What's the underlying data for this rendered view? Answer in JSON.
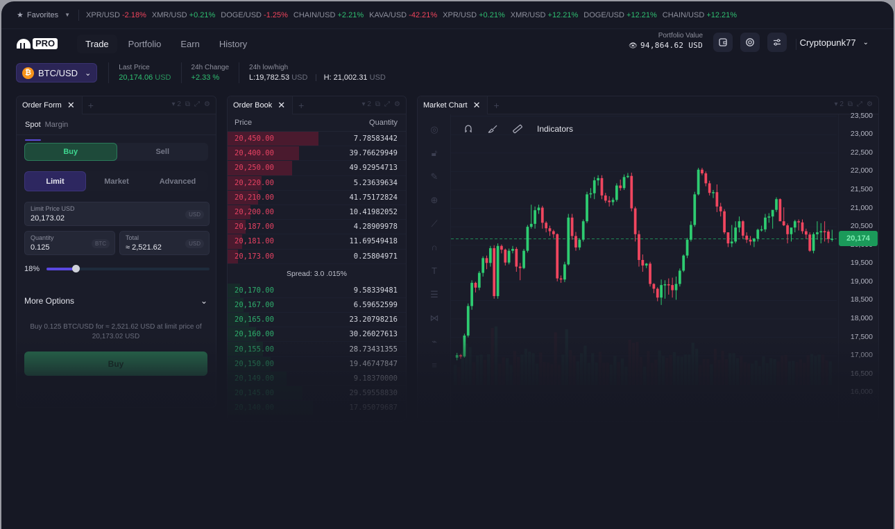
{
  "ticker": {
    "favorites_label": "Favorites",
    "items": [
      {
        "pair": "XPR/USD",
        "change": "-2.18%",
        "dir": "neg"
      },
      {
        "pair": "XMR/USD",
        "change": "+0.21%",
        "dir": "pos"
      },
      {
        "pair": "DOGE/USD",
        "change": "-1.25%",
        "dir": "neg"
      },
      {
        "pair": "CHAIN/USD",
        "change": "+2.21%",
        "dir": "pos"
      },
      {
        "pair": "KAVA/USD",
        "change": "-42.21%",
        "dir": "neg"
      },
      {
        "pair": "XPR/USD",
        "change": "+0.21%",
        "dir": "pos"
      },
      {
        "pair": "XMR/USD",
        "change": "+12.21%",
        "dir": "pos"
      },
      {
        "pair": "DOGE/USD",
        "change": "+12.21%",
        "dir": "pos"
      },
      {
        "pair": "CHAIN/USD",
        "change": "+12.21%",
        "dir": "pos"
      }
    ]
  },
  "nav": {
    "logo_text": "PRO",
    "tabs": [
      {
        "label": "Trade",
        "active": true
      },
      {
        "label": "Portfolio",
        "active": false
      },
      {
        "label": "Earn",
        "active": false
      },
      {
        "label": "History",
        "active": false
      }
    ],
    "portfolio_label": "Portfolio Value",
    "portfolio_value": "94,864.62 USD",
    "icons": [
      "wallet-icon",
      "support-icon",
      "settings-sliders-icon"
    ],
    "username": "Cryptopunk77"
  },
  "market": {
    "pair": "BTC/USD",
    "coin_symbol": "₿",
    "last_price_label": "Last Price",
    "last_price": "20,174.06",
    "last_price_unit": "USD",
    "change_label": "24h Change",
    "change_value": "+2.33 %",
    "lowhigh_label": "24h low/high",
    "low": "L:19,782.53",
    "high": "H: 21,002.31",
    "unit": "USD"
  },
  "order_form": {
    "title": "Order Form",
    "mode_tabs": [
      "Spot",
      "Margin"
    ],
    "active_mode": "Spot",
    "side_buy": "Buy",
    "side_sell": "Sell",
    "types": [
      "Limit",
      "Market",
      "Advanced"
    ],
    "active_type": "Limit",
    "limit_price_label": "Limit Price USD",
    "limit_price_value": "20,173.02",
    "limit_unit": "USD",
    "quantity_label": "Quantity",
    "quantity_value": "0.125",
    "quantity_unit": "BTC",
    "total_label": "Total",
    "total_value": "≈ 2,521.62",
    "total_unit": "USD",
    "slider_percent": 18,
    "slider_label": "18%",
    "more_options": "More Options",
    "summary": "Buy 0.125 BTC/USD for ≈ 2,521.62 USD at limit price of 20,173.02 USD",
    "submit_label": "Buy"
  },
  "order_book": {
    "title": "Order Book",
    "col_price": "Price",
    "col_quantity": "Quantity",
    "asks": [
      {
        "price": "20,450.00",
        "qty": "7.78583442",
        "depth": 0.51
      },
      {
        "price": "20,400.00",
        "qty": "39.76629949",
        "depth": 0.4
      },
      {
        "price": "20,250.00",
        "qty": "49.92954713",
        "depth": 0.36
      },
      {
        "price": "20,220.00",
        "qty": "5.23639634",
        "depth": 0.19
      },
      {
        "price": "20,210.00",
        "qty": "41.75172824",
        "depth": 0.17
      },
      {
        "price": "20,200.00",
        "qty": "10.41982052",
        "depth": 0.13
      },
      {
        "price": "20,187.00",
        "qty": "4.28909978",
        "depth": 0.1
      },
      {
        "price": "20,181.00",
        "qty": "11.69549418",
        "depth": 0.08
      },
      {
        "price": "20,173.00",
        "qty": "0.25804971",
        "depth": 0.06
      }
    ],
    "spread": "Spread: 3.0 .015%",
    "bids": [
      {
        "price": "20,170.00",
        "qty": "9.58339481",
        "depth": 0.07
      },
      {
        "price": "20,167.00",
        "qty": "6.59652599",
        "depth": 0.09
      },
      {
        "price": "20,165.00",
        "qty": "23.20798216",
        "depth": 0.12
      },
      {
        "price": "20,160.00",
        "qty": "30.26027613",
        "depth": 0.16
      },
      {
        "price": "20,155.00",
        "qty": "28.73431355",
        "depth": 0.2
      },
      {
        "price": "20,150.00",
        "qty": "19.46747847",
        "depth": 0.24
      },
      {
        "price": "20,149.00",
        "qty": "9.18370000",
        "depth": 0.33
      },
      {
        "price": "20,145.00",
        "qty": "29.59558830",
        "depth": 0.42
      },
      {
        "price": "20,140.00",
        "qty": "17.95079687",
        "depth": 0.48
      }
    ]
  },
  "market_chart": {
    "title": "Market Chart",
    "toolbar": [
      "magnet-icon",
      "brush-icon",
      "ruler-icon"
    ],
    "indicators_label": "Indicators",
    "current_price_label": "20,174",
    "current_price": 20174
  },
  "chart_data": {
    "type": "candlestick",
    "title": "BTC/USD",
    "ylim": [
      15800,
      23700
    ],
    "y_ticks": [
      "23,500",
      "23,000",
      "22,500",
      "22,000",
      "21,500",
      "21,000",
      "20,500",
      "20,000",
      "19,500",
      "19,000",
      "18,500",
      "18,000",
      "17,500",
      "17,000",
      "16,500",
      "16,000"
    ],
    "y_tick_values": [
      23500,
      23000,
      22500,
      22000,
      21500,
      21000,
      20500,
      20000,
      19500,
      19000,
      18500,
      18000,
      17500,
      17000,
      16500,
      16000
    ],
    "last_price": 20174,
    "candles": [
      [
        16950,
        17080,
        16880,
        17020
      ],
      [
        17020,
        17050,
        16920,
        16980
      ],
      [
        16980,
        17600,
        16950,
        17550
      ],
      [
        17550,
        18420,
        17500,
        18350
      ],
      [
        18350,
        19050,
        18250,
        18980
      ],
      [
        18980,
        19010,
        18720,
        18850
      ],
      [
        18850,
        19300,
        18780,
        19250
      ],
      [
        19250,
        19700,
        19150,
        19650
      ],
      [
        19650,
        19720,
        19350,
        19520
      ],
      [
        19520,
        19980,
        19420,
        19920
      ],
      [
        19920,
        20000,
        18550,
        18620
      ],
      [
        18620,
        20050,
        18550,
        19980
      ],
      [
        19980,
        20020,
        19780,
        19880
      ],
      [
        19880,
        19910,
        19450,
        19530
      ],
      [
        19530,
        19910,
        19480,
        19850
      ],
      [
        19850,
        19980,
        19780,
        19900
      ],
      [
        19900,
        19950,
        19280,
        19420
      ],
      [
        19420,
        19520,
        19050,
        19380
      ],
      [
        19380,
        19900,
        19350,
        19850
      ],
      [
        19850,
        20550,
        19800,
        20500
      ],
      [
        20500,
        21100,
        20450,
        20580
      ],
      [
        20580,
        21050,
        20450,
        20950
      ],
      [
        20950,
        21100,
        20850,
        21020
      ],
      [
        21020,
        21070,
        20450,
        20610
      ],
      [
        20610,
        20650,
        20350,
        20460
      ],
      [
        20460,
        20530,
        20250,
        20380
      ],
      [
        20380,
        20420,
        20200,
        20300
      ],
      [
        20300,
        20320,
        19020,
        19100
      ],
      [
        19100,
        19180,
        18980,
        19070
      ],
      [
        19070,
        19550,
        19000,
        19480
      ],
      [
        19480,
        20850,
        19450,
        20750
      ],
      [
        20750,
        20850,
        20150,
        20250
      ],
      [
        20250,
        20360,
        19850,
        19940
      ],
      [
        19940,
        20190,
        19870,
        20150
      ],
      [
        20150,
        20700,
        20100,
        20650
      ],
      [
        20650,
        21450,
        20600,
        21380
      ],
      [
        21380,
        21550,
        21280,
        21410
      ],
      [
        21410,
        21850,
        21250,
        21760
      ],
      [
        21760,
        21900,
        21620,
        21820
      ],
      [
        21820,
        21900,
        21250,
        21350
      ],
      [
        21350,
        21420,
        21150,
        21210
      ],
      [
        21210,
        21330,
        21050,
        21170
      ],
      [
        21170,
        21290,
        21080,
        21230
      ],
      [
        21230,
        21680,
        21180,
        21620
      ],
      [
        21620,
        21780,
        21480,
        21550
      ],
      [
        21550,
        21920,
        21500,
        21850
      ],
      [
        21850,
        21960,
        21820,
        21880
      ],
      [
        21880,
        21970,
        20920,
        21000
      ],
      [
        21000,
        21050,
        20100,
        20300
      ],
      [
        20300,
        20400,
        19420,
        19600
      ],
      [
        19600,
        19750,
        19280,
        19450
      ],
      [
        19450,
        19520,
        19380,
        19500
      ],
      [
        19500,
        19550,
        18880,
        18950
      ],
      [
        18950,
        18970,
        18700,
        18820
      ],
      [
        18820,
        18860,
        18480,
        18580
      ],
      [
        18580,
        19070,
        18380,
        18920
      ],
      [
        18920,
        19050,
        18550,
        18940
      ],
      [
        18940,
        19100,
        18660,
        18920
      ],
      [
        18920,
        19120,
        18580,
        18780
      ],
      [
        18780,
        19150,
        18520,
        18950
      ],
      [
        18950,
        19370,
        18880,
        19310
      ],
      [
        19310,
        19750,
        19270,
        19720
      ],
      [
        19720,
        20200,
        19650,
        20150
      ],
      [
        20150,
        20650,
        20100,
        20550
      ],
      [
        20550,
        21450,
        20500,
        21380
      ],
      [
        21380,
        22100,
        21350,
        22050
      ],
      [
        22050,
        22100,
        21900,
        21950
      ],
      [
        21950,
        22000,
        21600,
        21680
      ],
      [
        21680,
        21750,
        21350,
        21420
      ],
      [
        21420,
        21500,
        21280,
        21440
      ],
      [
        21440,
        21650,
        20900,
        21050
      ],
      [
        21050,
        21150,
        20780,
        20920
      ],
      [
        20920,
        20980,
        20300,
        20350
      ],
      [
        20350,
        20350,
        19950,
        20050
      ],
      [
        20050,
        20550,
        19950,
        20100
      ],
      [
        20100,
        20650,
        20050,
        20480
      ],
      [
        20480,
        20780,
        20350,
        20650
      ],
      [
        20650,
        20680,
        20180,
        20260
      ],
      [
        20260,
        20350,
        20060,
        20150
      ],
      [
        20150,
        20250,
        20000,
        20100
      ],
      [
        20100,
        20200,
        19950,
        20180
      ],
      [
        20180,
        20450,
        20100,
        20420
      ],
      [
        20420,
        20530,
        20370,
        20430
      ],
      [
        20430,
        20850,
        20360,
        20750
      ],
      [
        20750,
        20870,
        20610,
        20780
      ],
      [
        20780,
        20880,
        20450,
        20960
      ],
      [
        20960,
        21300,
        20900,
        21250
      ],
      [
        21250,
        21270,
        20950,
        20650
      ],
      [
        20650,
        21030,
        20520,
        20540
      ],
      [
        20540,
        20590,
        20050,
        20300
      ],
      [
        20300,
        20420,
        20100,
        20480
      ],
      [
        20480,
        20690,
        20350,
        20650
      ],
      [
        20650,
        20700,
        20400,
        20620
      ],
      [
        20620,
        20700,
        20310,
        20380
      ],
      [
        20380,
        20450,
        20180,
        20290
      ],
      [
        20290,
        20350,
        19820,
        19850
      ],
      [
        19850,
        20350,
        19780,
        20300
      ],
      [
        20300,
        20650,
        20150,
        20350
      ],
      [
        20350,
        20600,
        20050,
        20380
      ],
      [
        20380,
        20650,
        20100,
        20370
      ],
      [
        20370,
        20420,
        20060,
        20170
      ],
      [
        20170,
        20420,
        20100,
        20174
      ]
    ]
  }
}
